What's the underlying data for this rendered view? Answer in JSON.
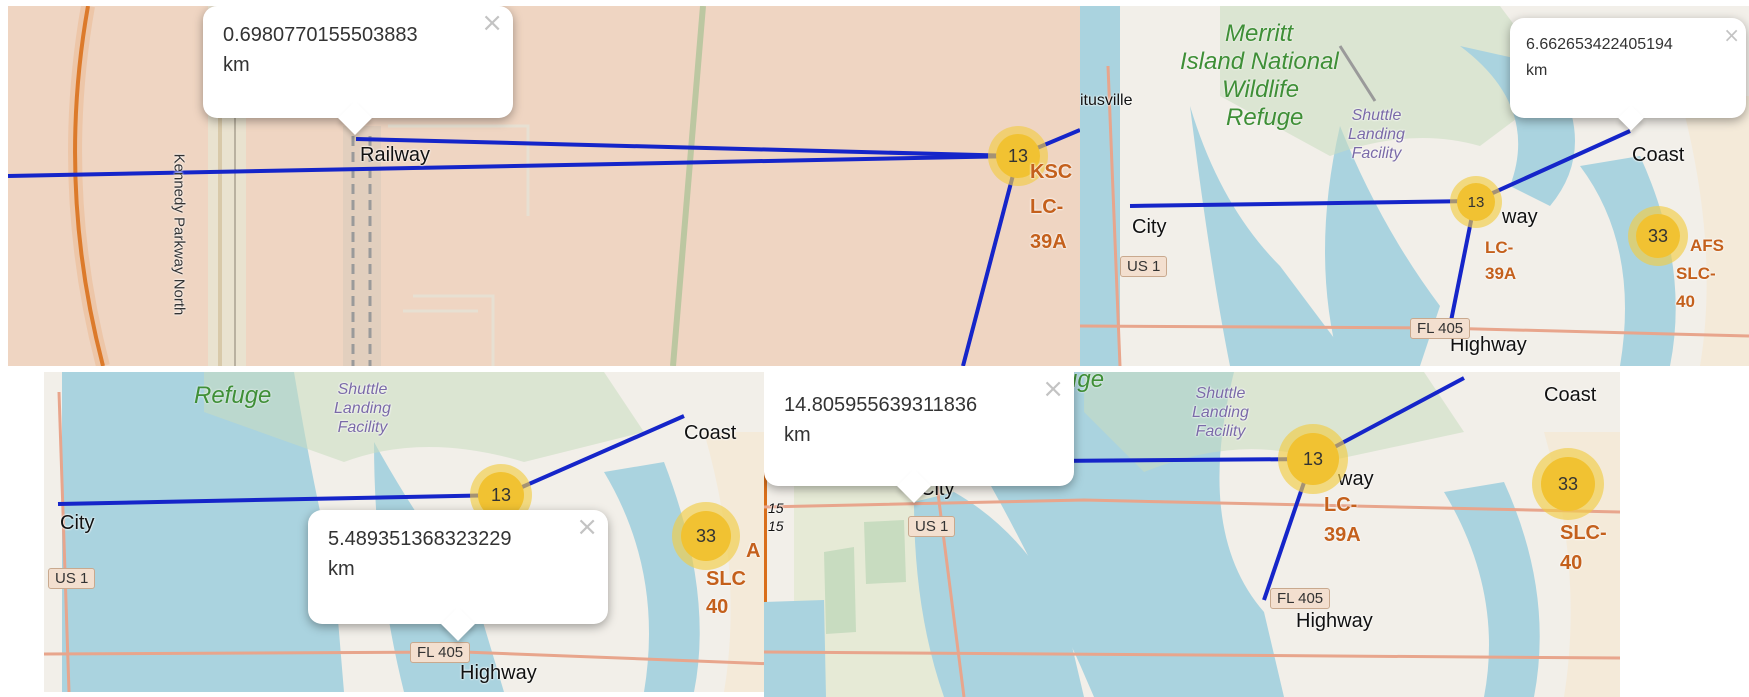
{
  "panel1": {
    "popup": {
      "value": "0.6980770155503883",
      "unit": "km",
      "close": "×"
    },
    "road_label": "Kennedy Parkway North",
    "labels": {
      "railway": "Railway",
      "pad_a": "KSC",
      "pad_b": "LC-",
      "pad_c": "39A"
    },
    "cluster": "13"
  },
  "panel2": {
    "popup": {
      "value": "6.662653422405194",
      "unit": "km",
      "close": "×"
    },
    "refuge": [
      "Merritt",
      "Island National",
      "Wildlife",
      "Refuge"
    ],
    "facility": [
      "Shuttle",
      "Landing",
      "Facility"
    ],
    "town": "itusville",
    "labels": {
      "city": "City",
      "coast": "Coast",
      "highway": "Highway",
      "partial_way": "way",
      "lc_a": "LC-",
      "lc_b": "39A",
      "afs": "AFS",
      "slc_a": "SLC-",
      "slc_b": "40"
    },
    "shields": {
      "us1": "US 1",
      "fl405": "FL 405"
    },
    "clusters": [
      "13",
      "33"
    ]
  },
  "panel3": {
    "popup": {
      "value": "5.489351368323229",
      "unit": "km",
      "close": "×"
    },
    "refuge": "Refuge",
    "facility": [
      "Shuttle",
      "Landing",
      "Facility"
    ],
    "labels": {
      "city": "City",
      "coast": "Coast",
      "highway": "Highway",
      "afs_frag": "A",
      "slc_a": "SLC",
      "slc_b": "40"
    },
    "shields": {
      "us1": "US 1",
      "fl405": "FL 405"
    },
    "clusters": [
      "13",
      "33"
    ]
  },
  "panel4": {
    "popup": {
      "value": "14.805955639311836",
      "unit": "km",
      "close": "×"
    },
    "refuge": "uge",
    "facility": [
      "Shuttle",
      "Landing",
      "Facility"
    ],
    "labels": {
      "city": "City",
      "coast": "Coast",
      "highway": "Highway",
      "partial_way": "way",
      "lc_a": "LC-",
      "lc_b": "39A",
      "slc_a": "SLC-",
      "slc_b": "40",
      "mile_a": "15",
      "mile_b": "15"
    },
    "shields": {
      "us1": "US 1",
      "fl405": "FL 405"
    },
    "clusters": [
      "13",
      "33"
    ]
  },
  "colors": {
    "route": "#1525c9",
    "water": "#aad3df",
    "land": "#f2efe9",
    "urban": "#efd5c2",
    "wetland": "#c8dcc0",
    "cluster": "#f1c232",
    "pad_label": "#c4601c"
  }
}
